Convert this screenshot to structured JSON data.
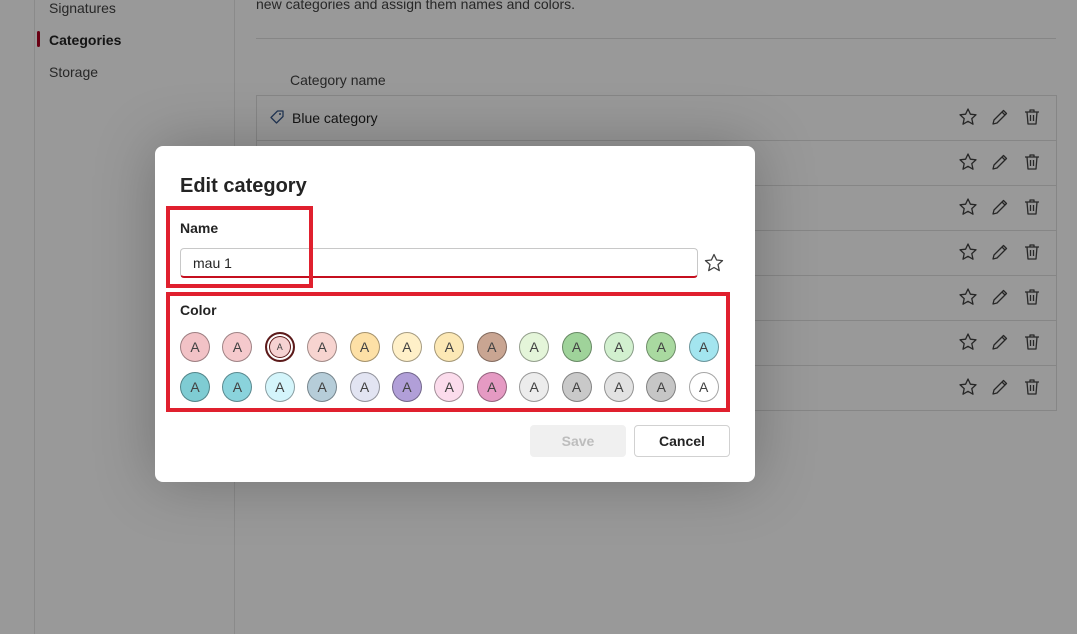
{
  "sidebar": {
    "items": [
      {
        "label": "Signatures",
        "active": false
      },
      {
        "label": "Categories",
        "active": true
      },
      {
        "label": "Storage",
        "active": false
      }
    ]
  },
  "main": {
    "description": "new categories and assign them names and colors.",
    "column_header": "Category name",
    "rows": [
      {
        "name": "Blue category"
      }
    ]
  },
  "dialog": {
    "title": "Edit category",
    "name_label": "Name",
    "name_value": "mau 1",
    "color_label": "Color",
    "swatch_letter": "A",
    "swatches_row1": [
      "#f2c2c6",
      "#f5c9cc",
      "#f6d2d2",
      "#f7d4d0",
      "#fde0a6",
      "#fff0c8",
      "#fce8b5",
      "#c9a592",
      "#e4f5d9",
      "#9fd39a",
      "#d2f0cf",
      "#a9d9a0",
      "#a3e5ef"
    ],
    "swatches_row2": [
      "#7fccd3",
      "#8ad3dc",
      "#d4f5fb",
      "#b6cdd9",
      "#e2e4f2",
      "#b19fd8",
      "#fbdcec",
      "#e59ac3",
      "#ececec",
      "#c9c9c9",
      "#e2e2e2",
      "#c6c6c6",
      "#ffffff"
    ],
    "selected_swatch": 2,
    "save_label": "Save",
    "cancel_label": "Cancel"
  },
  "colors": {
    "accent": "#c50f1f",
    "highlight": "#e0202e",
    "nav_indicator": "#b00020"
  }
}
